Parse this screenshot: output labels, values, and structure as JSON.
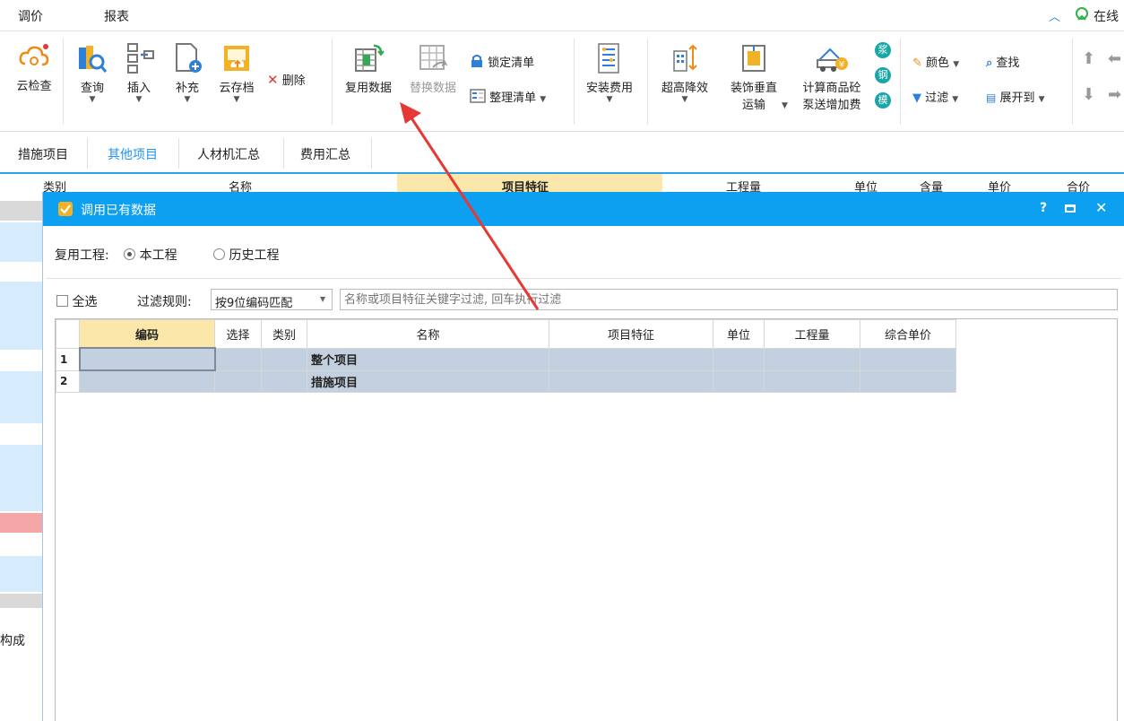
{
  "menu": {
    "item1": "调价",
    "item2": "报表",
    "status": "在线"
  },
  "ribbon": {
    "cloud_check": "云检查",
    "query": "查询",
    "insert": "插入",
    "supplement": "补充",
    "cloud_save": "云存档",
    "delete": "删除",
    "reuse_data": "复用数据",
    "replace_data": "替换数据",
    "lock_list": "锁定清单",
    "organize_list": "整理清单",
    "install_fee": "安装费用",
    "super_high": "超高降效",
    "decor_vertical_1": "装饰垂直",
    "decor_vertical_2": "运输",
    "concrete_1": "计算商品砼",
    "concrete_2": "泵送增加费",
    "circle_labels": [
      "浆",
      "钢",
      "模"
    ],
    "color": "颜色",
    "find": "查找",
    "filter": "过滤",
    "expand_to": "展开到"
  },
  "tabs": [
    "措施项目",
    "其他项目",
    "人材机汇总",
    "费用汇总"
  ],
  "bg_table_header": [
    "类别",
    "名称",
    "项目特征",
    "工程量",
    "单位",
    "含量",
    "单价",
    "合价"
  ],
  "bg_left_text": "构成",
  "dialog": {
    "title": "调用已有数据",
    "reuse_project_label": "复用工程:",
    "option_current": "本工程",
    "option_history": "历史工程",
    "select_all": "全选",
    "filter_rule_label": "过滤规则:",
    "filter_rule_value": "按9位编码匹配",
    "filter_placeholder": "名称或项目特征关键字过滤, 回车执行过滤",
    "columns": [
      "编码",
      "选择",
      "类别",
      "名称",
      "项目特征",
      "单位",
      "工程量",
      "综合单价"
    ],
    "rows": [
      {
        "index": "1",
        "name": "整个项目"
      },
      {
        "index": "2",
        "name": "措施项目"
      }
    ]
  },
  "colors": {
    "title_bar": "#0d9ff0",
    "tab_active": "#2196f3",
    "header_highlight": "#fbe7a9",
    "row_fill": "#c3d0e0",
    "arrow": "#e53935"
  },
  "icons": [
    "cloud-check-icon",
    "query-icon",
    "insert-icon",
    "supplement-icon",
    "cloud-save-icon",
    "delete-icon",
    "reuse-data-icon",
    "replace-data-icon",
    "lock-icon",
    "organize-list-icon",
    "install-fee-icon",
    "super-high-icon",
    "decor-vertical-icon",
    "concrete-truck-icon",
    "color-icon",
    "binoculars-icon",
    "filter-icon",
    "expand-icon",
    "arrow-up-icon",
    "arrow-down-icon",
    "arrow-left-icon",
    "arrow-right-icon",
    "help-icon",
    "maximize-icon",
    "close-icon",
    "dialog-app-icon",
    "online-status-icon",
    "collapse-ribbon-icon"
  ]
}
